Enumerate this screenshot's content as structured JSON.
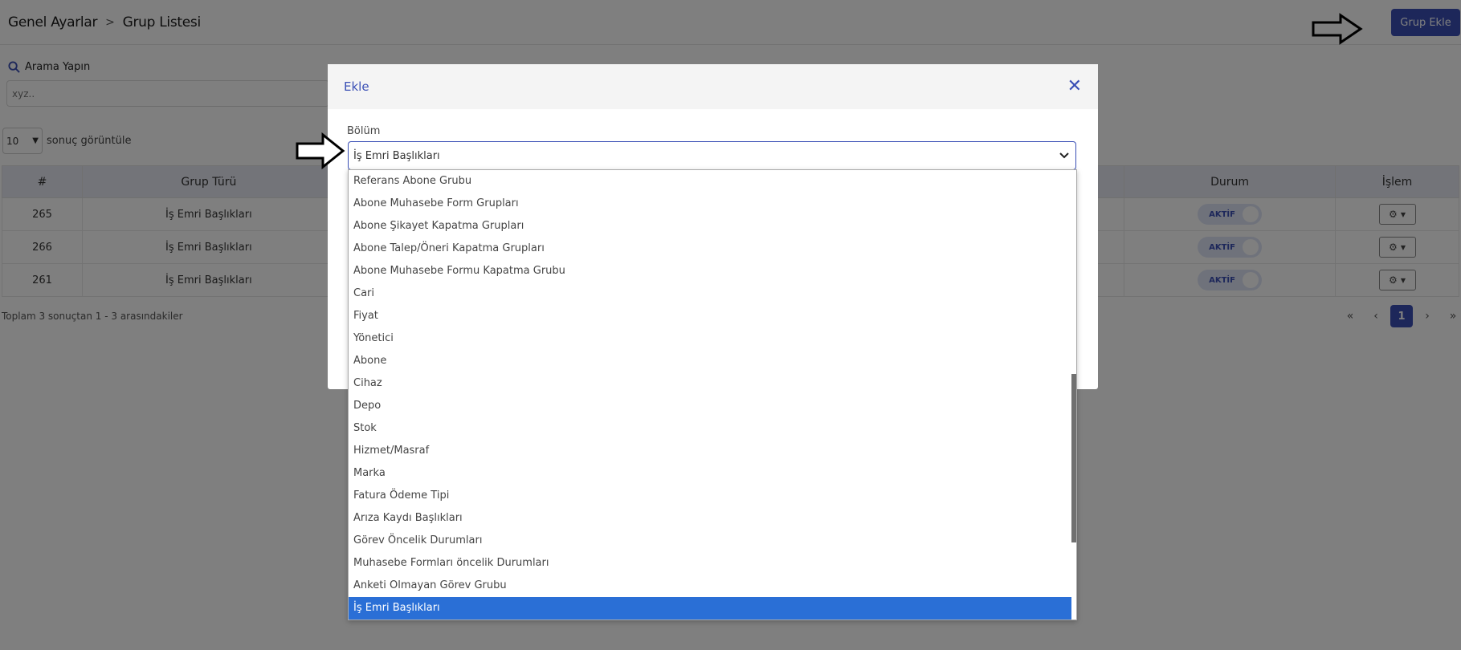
{
  "breadcrumb": {
    "parent": "Genel Ayarlar",
    "separator": ">",
    "current": "Grup Listesi"
  },
  "header": {
    "add_button": "Grup Ekle"
  },
  "search": {
    "label": "Arama Yapın",
    "placeholder": "xyz.."
  },
  "pagination_size": {
    "value": "10",
    "label": "sonuç görüntüle"
  },
  "table": {
    "headers": [
      "#",
      "Grup Türü",
      "Durum",
      "İşlem"
    ],
    "rows": [
      {
        "id": "265",
        "type": "İş Emri Başlıkları",
        "status": "AKTİF"
      },
      {
        "id": "266",
        "type": "İş Emri Başlıkları",
        "status": "AKTİF"
      },
      {
        "id": "261",
        "type": "İş Emri Başlıkları",
        "status": "AKTİF"
      }
    ]
  },
  "summary": "Toplam 3 sonuçtan 1 - 3 arasındakiler",
  "pager": {
    "first": "«",
    "prev": "‹",
    "current": "1",
    "next": "›",
    "last": "»"
  },
  "modal": {
    "title": "Ekle",
    "field_label": "Bölüm",
    "selected_value": "İş Emri Başlıkları",
    "options": [
      "Referans Abone Grubu",
      "Abone Muhasebe Form Grupları",
      "Abone Şikayet Kapatma Grupları",
      "Abone Talep/Öneri Kapatma Grupları",
      "Abone Muhasebe Formu Kapatma Grubu",
      "Cari",
      "Fiyat",
      "Yönetici",
      "Abone",
      "Cihaz",
      "Depo",
      "Stok",
      "Hizmet/Masraf",
      "Marka",
      "Fatura Ödeme Tipi",
      "Arıza Kaydı Başlıkları",
      "Görev Öncelik Durumları",
      "Muhasebe Formları öncelik Durumları",
      "Anketi Olmayan Görev Grubu",
      "İş Emri Başlıkları"
    ],
    "selected_index": 19
  },
  "colors": {
    "primary": "#3a4fb5",
    "highlight": "#2a6fd6"
  }
}
